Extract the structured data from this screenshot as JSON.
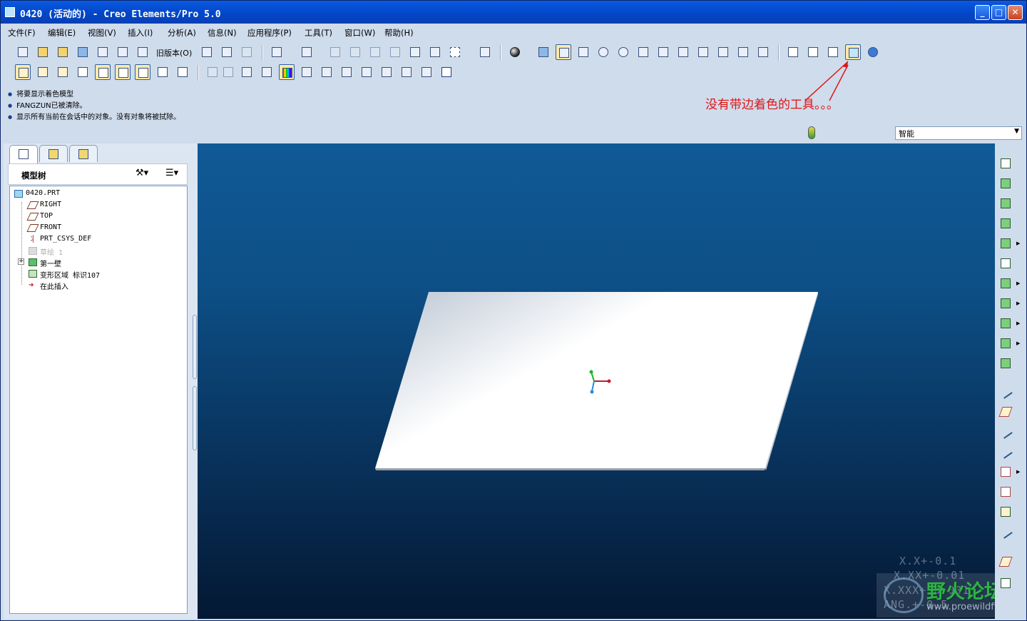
{
  "window": {
    "title": "0420 (活动的) - Creo Elements/Pro 5.0",
    "minimize": "_",
    "maximize": "□",
    "close": "✕"
  },
  "menu": [
    "文件(F)",
    "编辑(E)",
    "视图(V)",
    "插入(I)",
    "分析(A)",
    "信息(N)",
    "应用程序(P)",
    "工具(T)",
    "窗口(W)",
    "帮助(H)"
  ],
  "toolbar": {
    "old_version_label": "旧版本(O)"
  },
  "messages": [
    "将要显示着色模型",
    "FANGZUN已被清除。",
    "显示所有当前在会话中的对象。没有对象将被拭除。"
  ],
  "annotation": "没有带边着色的工具。。。",
  "filter": {
    "selected": "智能"
  },
  "model_tree": {
    "title": "模型树",
    "settings_icon": "hammer-icon",
    "items": [
      {
        "label": "0420.PRT",
        "icon": "part-icon"
      },
      {
        "label": "RIGHT",
        "icon": "datum-plane-icon"
      },
      {
        "label": "TOP",
        "icon": "datum-plane-icon"
      },
      {
        "label": "FRONT",
        "icon": "datum-plane-icon"
      },
      {
        "label": "PRT_CSYS_DEF",
        "icon": "csys-icon"
      },
      {
        "label": "草绘 1",
        "icon": "sketch-icon"
      },
      {
        "label": "第一壁",
        "icon": "flat-wall-icon"
      },
      {
        "label": "变形区域 标识107",
        "icon": "deform-area-icon"
      },
      {
        "label": "在此插入",
        "icon": "insert-here-arrow-icon"
      }
    ]
  },
  "graphics": {
    "dims": [
      "X.X+-0.1",
      "X.XX+-0.01",
      "X.XXX+-0.001",
      "ANG.+-0.5"
    ],
    "watermark_text": "野火论坛",
    "watermark_url": "www.proewildfire.cn",
    "colors": {
      "bg_top": "#105a97",
      "bg_bottom": "#041833",
      "plate": "#ffffff"
    }
  }
}
